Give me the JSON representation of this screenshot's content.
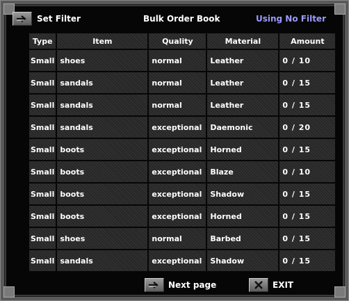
{
  "header": {
    "set_filter_label": "Set Filter",
    "title": "Bulk Order Book",
    "filter_status": "Using No Filter"
  },
  "columns": [
    "Type",
    "Item",
    "Quality",
    "Material",
    "Amount"
  ],
  "rows": [
    {
      "type": "Small",
      "item": "shoes",
      "quality": "normal",
      "material": "Leather",
      "amount": "0 / 10"
    },
    {
      "type": "Small",
      "item": "sandals",
      "quality": "normal",
      "material": "Leather",
      "amount": "0 / 15"
    },
    {
      "type": "Small",
      "item": "sandals",
      "quality": "normal",
      "material": "Leather",
      "amount": "0 / 15"
    },
    {
      "type": "Small",
      "item": "sandals",
      "quality": "exceptional",
      "material": "Daemonic",
      "amount": "0 / 20"
    },
    {
      "type": "Small",
      "item": "boots",
      "quality": "exceptional",
      "material": "Horned",
      "amount": "0 / 15"
    },
    {
      "type": "Small",
      "item": "boots",
      "quality": "exceptional",
      "material": "Blaze",
      "amount": "0 / 10"
    },
    {
      "type": "Small",
      "item": "boots",
      "quality": "exceptional",
      "material": "Shadow",
      "amount": "0 / 15"
    },
    {
      "type": "Small",
      "item": "boots",
      "quality": "exceptional",
      "material": "Horned",
      "amount": "0 / 15"
    },
    {
      "type": "Small",
      "item": "shoes",
      "quality": "normal",
      "material": "Barbed",
      "amount": "0 / 15"
    },
    {
      "type": "Small",
      "item": "sandals",
      "quality": "exceptional",
      "material": "Shadow",
      "amount": "0 / 15"
    }
  ],
  "footer": {
    "next_page_label": "Next page",
    "exit_label": "EXIT"
  },
  "colors": {
    "filter_status": "#9a9aff",
    "text": "#ffffff",
    "cell_bg": "#2b2b2b",
    "frame": "#5a5a5a"
  },
  "icons": {
    "set_filter": "arrow-right-icon",
    "next_page": "arrow-right-icon",
    "exit": "close-icon"
  }
}
